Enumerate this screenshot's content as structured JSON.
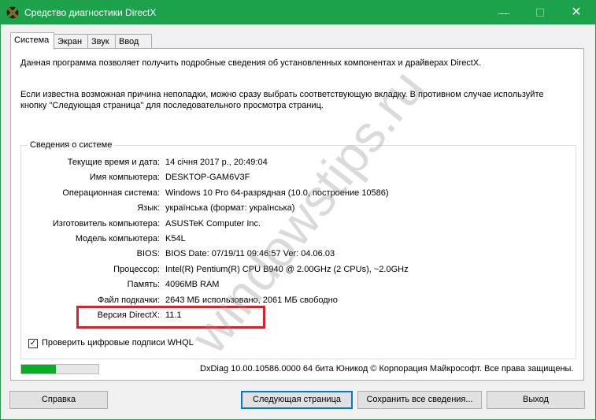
{
  "window": {
    "title": "Средство диагностики DirectX",
    "minimize_glyph": "—",
    "maximize_glyph": "☐",
    "close_glyph": "✕"
  },
  "tabs": [
    {
      "label": "Система",
      "active": true
    },
    {
      "label": "Экран",
      "active": false
    },
    {
      "label": "Звук",
      "active": false
    },
    {
      "label": "Ввод",
      "active": false
    }
  ],
  "intro": {
    "line1": "Данная программа позволяет получить подробные сведения об установленных компонентах и драйверах DirectX.",
    "line2": "Если известна возможная причина неполадки, можно сразу выбрать соответствующую вкладку. В противном случае используйте кнопку \"Следующая страница\" для последовательного просмотра страниц."
  },
  "system_info": {
    "legend": "Сведения о системе",
    "rows": [
      {
        "label": "Текущие время и дата:",
        "value": "14 січня 2017 р., 20:49:04"
      },
      {
        "label": "Имя компьютера:",
        "value": "DESKTOP-GAM6V3F"
      },
      {
        "label": "Операционная система:",
        "value": "Windows 10 Pro 64-разрядная (10.0, построение 10586)"
      },
      {
        "label": "Язык:",
        "value": "українська (формат: українська)"
      },
      {
        "label": "Изготовитель компьютера:",
        "value": "ASUSTeK Computer Inc."
      },
      {
        "label": "Модель компьютера:",
        "value": "K54L"
      },
      {
        "label": "BIOS:",
        "value": "BIOS Date: 07/19/11 09:46:57 Ver: 04.06.03"
      },
      {
        "label": "Процессор:",
        "value": "Intel(R) Pentium(R) CPU B940 @ 2.00GHz (2 CPUs), ~2.0GHz"
      },
      {
        "label": "Память:",
        "value": "4096MB RAM"
      },
      {
        "label": "Файл подкачки:",
        "value": "2643 МБ использовано, 2061 МБ свободно"
      },
      {
        "label": "Версия DirectX:",
        "value": "11.1"
      }
    ]
  },
  "whql": {
    "label": "Проверить цифровые подписи WHQL",
    "checked": true,
    "check_glyph": "✓"
  },
  "progress": {
    "fraction": 0.45
  },
  "footer": {
    "text": "DxDiag 10.00.10586.0000 64 бита Юникод  © Корпорация Майкрософт. Все права защищены."
  },
  "buttons": {
    "help": "Справка",
    "next": "Следующая страница",
    "save": "Сохранить все сведения...",
    "exit": "Выход"
  },
  "watermark": "windowstips.ru",
  "colors": {
    "titlebar": "#1ba24b",
    "highlight": "#d6232a",
    "progress": "#06b025"
  }
}
